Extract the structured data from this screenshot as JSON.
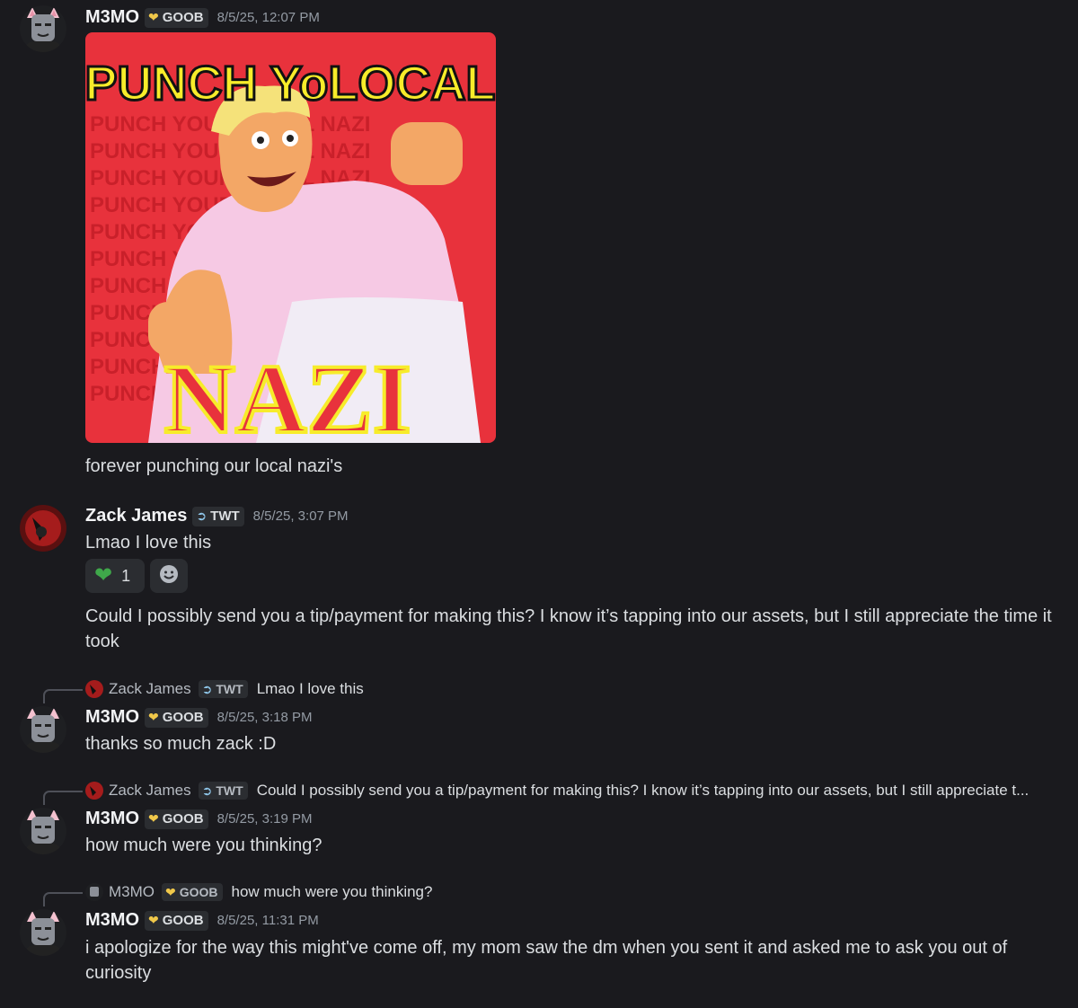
{
  "messages": [
    {
      "author": "M3MO",
      "tag": "GOOB",
      "time": "8/5/25, 12:07 PM",
      "text": "forever punching our local nazi's",
      "image": {
        "top_text": "PUNCH YoLOCAL",
        "bottom_text": "NAZI",
        "bg_text": "PUNCH YOUR LOCAL NAZI"
      }
    },
    {
      "author": "Zack James",
      "tag": "TWT",
      "time": "8/5/25, 3:07 PM",
      "text": "Lmao I love this",
      "reaction_count": "1",
      "followup": "Could I possibly send you a tip/payment for making this? I know it’s tapping into our assets, but I still appreciate the time it took"
    },
    {
      "reply_to": {
        "author": "Zack James",
        "tag": "TWT",
        "text": "Lmao I love this"
      },
      "author": "M3MO",
      "tag": "GOOB",
      "time": "8/5/25, 3:18 PM",
      "text": "thanks so much zack :D"
    },
    {
      "reply_to": {
        "author": "Zack James",
        "tag": "TWT",
        "text": "Could I possibly send you a tip/payment for making this? I know it’s tapping into our assets, but I still appreciate t..."
      },
      "author": "M3MO",
      "tag": "GOOB",
      "time": "8/5/25, 3:19 PM",
      "text": "how much were you thinking?"
    },
    {
      "reply_to": {
        "author": "M3MO",
        "tag": "GOOB",
        "text": "how much were you thinking?"
      },
      "author": "M3MO",
      "tag": "GOOB",
      "time": "8/5/25, 11:31 PM",
      "text": "i apologize for the way this might've come off, my mom saw the dm when you sent it and asked me to ask you out of curiosity"
    }
  ],
  "colors": {
    "background": "#1a1a1e",
    "goob_badge": "#f0c84a",
    "twt_badge": "#8ec5e8",
    "heart": "#3fa84a"
  },
  "icons": {
    "goob": "yellow-heart-icon",
    "twt": "feather-icon",
    "reaction": "green-heart-icon",
    "add_reaction": "smiley-icon"
  }
}
